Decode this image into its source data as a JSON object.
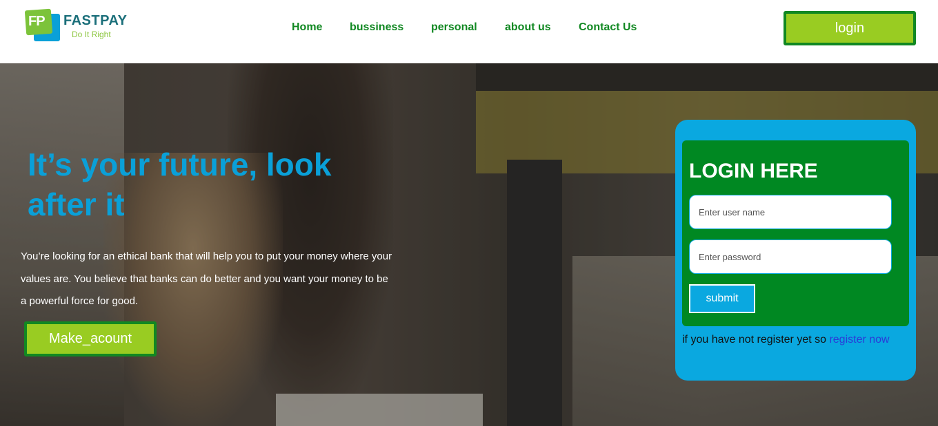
{
  "brand": {
    "name": "FASTPAY",
    "tagline": "Do It Right",
    "mark": "FP"
  },
  "nav": {
    "items": [
      {
        "label": "Home"
      },
      {
        "label": "bussiness"
      },
      {
        "label": "personal"
      },
      {
        "label": "about us"
      },
      {
        "label": "Contact Us"
      }
    ]
  },
  "header": {
    "login_label": "login"
  },
  "hero": {
    "title": "It’s your future, look after it",
    "text": "You’re looking for an ethical bank that will help you to put your money where your values are. You believe that banks can do better and you want your money to be a powerful force for good.",
    "cta_label": "Make_acount"
  },
  "login_form": {
    "title": "LOGIN HERE",
    "username_placeholder": "Enter user name",
    "password_placeholder": "Enter password",
    "submit_label": "submit",
    "register_prompt": "if you have not register yet so",
    "register_link": "register now"
  },
  "colors": {
    "brand_green": "#118822",
    "accent_lime": "#99cc22",
    "accent_blue": "#0aa8e0"
  }
}
